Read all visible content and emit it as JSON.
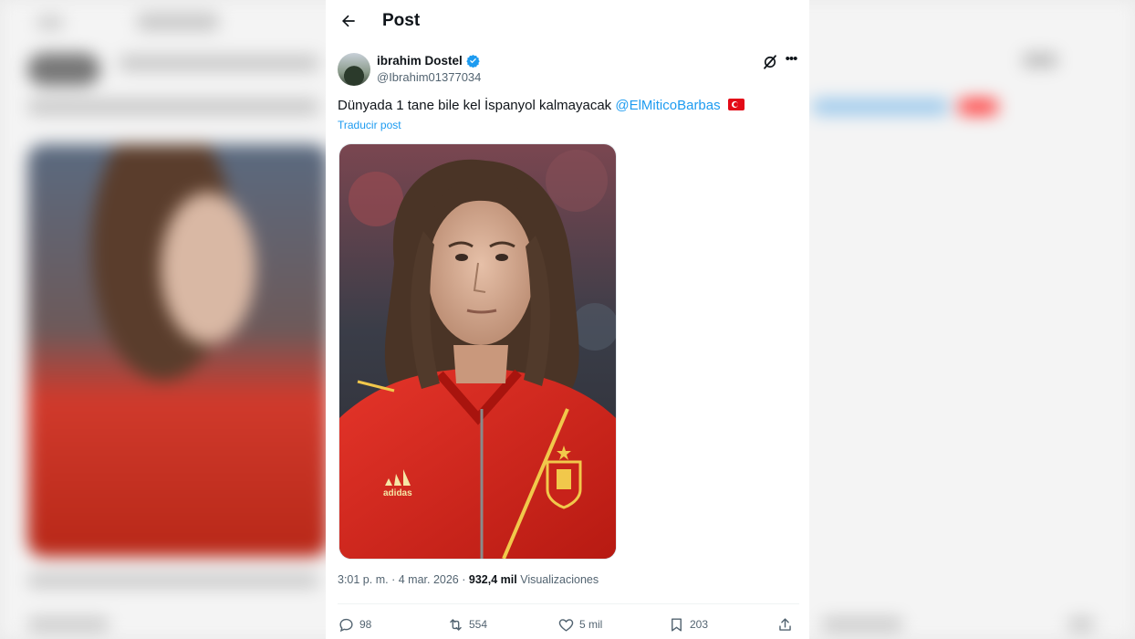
{
  "header": {
    "title": "Post"
  },
  "post": {
    "author": {
      "display_name": "ibrahim Dostel",
      "handle": "@Ibrahim01377034",
      "verified": true
    },
    "text": "Dünyada 1 tane bile kel İspanyol kalmayacak",
    "mention": "@ElMiticoBarbas",
    "flag_icon": "turkey-flag-icon",
    "translate_label": "Traducir post",
    "image_description_icon": "photo",
    "time": "3:01 p. m.",
    "separator": "·",
    "date": "4 mar. 2026",
    "views_count": "932,4 mil",
    "views_label": "Visualizaciones"
  },
  "actions": {
    "replies": "98",
    "reposts": "554",
    "likes": "5 mil",
    "bookmarks": "203"
  },
  "colors": {
    "accent": "#1d9bf0",
    "text": "#0f1419",
    "secondary_text": "#536471",
    "flag_red": "#e30a17"
  },
  "icons": [
    "back-arrow-icon",
    "verified-badge-icon",
    "grok-icon",
    "more-icon",
    "reply-icon",
    "repost-icon",
    "like-icon",
    "bookmark-icon",
    "share-icon"
  ]
}
